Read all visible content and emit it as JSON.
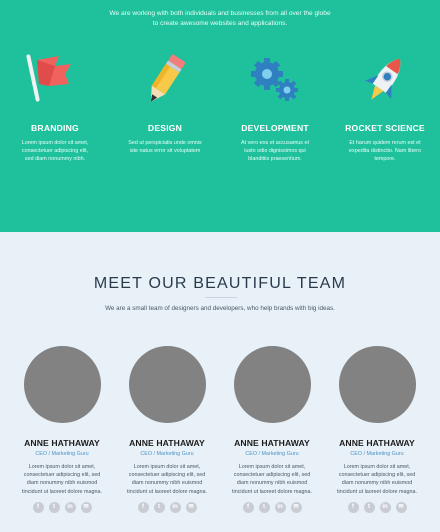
{
  "services": {
    "intro_line1": "We are working with both individuals and businesses from all over the globe",
    "intro_line2": "to create awesome websites and applications.",
    "items": [
      {
        "icon": "flag-icon",
        "title": "BRANDING",
        "desc": "Lorem ipsum dolor sit amet, consectetuer adipiscing elit, sed diam nonummy nibh."
      },
      {
        "icon": "pencil-icon",
        "title": "DESIGN",
        "desc": "Sed ut perspiciatis unde omnis iste natus error sit voluptatem"
      },
      {
        "icon": "gears-icon",
        "title": "DEVELOPMENT",
        "desc": "At vero eos et accusamus et iusto odio dignissimos qui blanditiis praesentium."
      },
      {
        "icon": "rocket-icon",
        "title": "ROCKET SCIENCE",
        "desc": "Et harum quidem rerum est et expedita distinctio. Nam libero tempore."
      }
    ]
  },
  "team": {
    "title": "MEET OUR BEAUTIFUL TEAM",
    "subtitle": "We are a small team of designers and developers, who help brands with big ideas.",
    "members": [
      {
        "name": "ANNE HATHAWAY",
        "role": "CEO / Marketing Guru",
        "bio": "Lorem ipsum dolor sit amet, consectetuer adipiscing elit, sed diam nonummy nibh euismod tincidunt ut laoreet dolore magna."
      },
      {
        "name": "ANNE HATHAWAY",
        "role": "CEO / Marketing Guru",
        "bio": "Lorem ipsum dolor sit amet, consectetuer adipiscing elit, sed diam nonummy nibh euismod tincidunt ut laoreet dolore magna."
      },
      {
        "name": "ANNE HATHAWAY",
        "role": "CEO / Marketing Guru",
        "bio": "Lorem ipsum dolor sit amet, consectetuer adipiscing elit, sed diam nonummy nibh euismod tincidunt ut laoreet dolore magna."
      },
      {
        "name": "ANNE HATHAWAY",
        "role": "CEO / Marketing Guru",
        "bio": "Lorem ipsum dolor sit amet, consectetuer adipiscing elit, sed diam nonummy nibh euismod tincidunt ut laoreet dolore magna."
      }
    ],
    "social_icons": [
      "facebook-icon",
      "twitter-icon",
      "linkedin-icon",
      "email-icon"
    ],
    "social_glyphs": [
      "f",
      "t",
      "in",
      "✉"
    ]
  },
  "colors": {
    "services_bg": "#1fc09c",
    "team_bg": "#e9f1f8",
    "avatar": "#828282",
    "role_text": "#4b93c7",
    "social_bg": "#c7cdd3"
  }
}
